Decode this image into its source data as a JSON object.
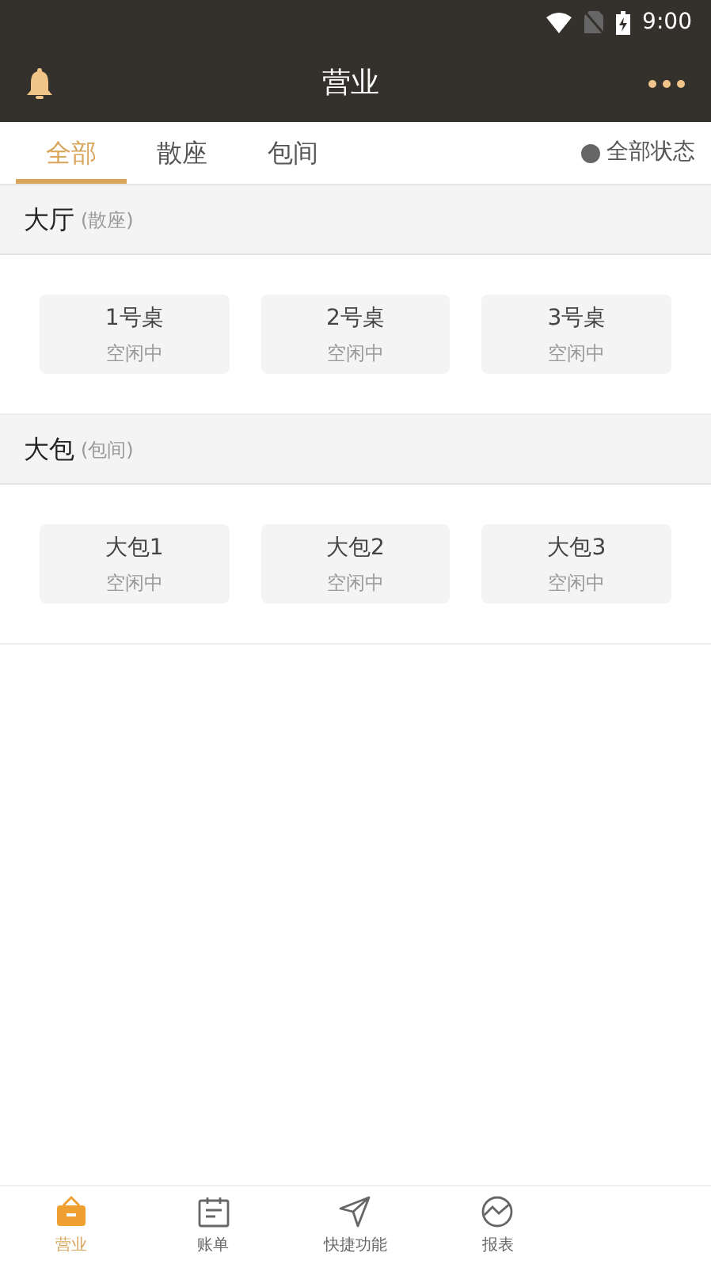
{
  "status_bar": {
    "time": "9:00"
  },
  "header": {
    "title": "营业"
  },
  "tabs": [
    {
      "label": "全部",
      "selected": true
    },
    {
      "label": "散座",
      "selected": false
    },
    {
      "label": "包间",
      "selected": false
    }
  ],
  "status_filter": {
    "label": "全部状态"
  },
  "sections": [
    {
      "title": "大厅",
      "subtitle": "(散座)",
      "tables": [
        {
          "name": "1号桌",
          "status": "空闲中"
        },
        {
          "name": "2号桌",
          "status": "空闲中"
        },
        {
          "name": "3号桌",
          "status": "空闲中"
        }
      ]
    },
    {
      "title": "大包",
      "subtitle": "(包间)",
      "tables": [
        {
          "name": "大包1",
          "status": "空闲中"
        },
        {
          "name": "大包2",
          "status": "空闲中"
        },
        {
          "name": "大包3",
          "status": "空闲中"
        }
      ]
    }
  ],
  "bottom_nav": [
    {
      "label": "营业",
      "selected": true
    },
    {
      "label": "账单",
      "selected": false
    },
    {
      "label": "快捷功能",
      "selected": false
    },
    {
      "label": "报表",
      "selected": false
    }
  ]
}
